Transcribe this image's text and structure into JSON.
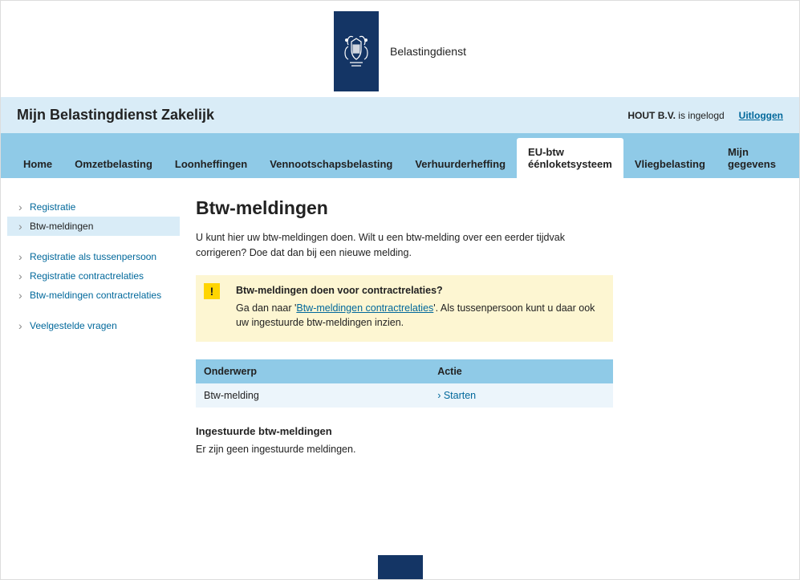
{
  "header": {
    "brand": "Belastingdienst"
  },
  "titleBar": {
    "title": "Mijn Belastingdienst Zakelijk",
    "userName": "HOUT B.V.",
    "loggedInSuffix": " is ingelogd",
    "logout": "Uitloggen"
  },
  "nav": {
    "items": [
      {
        "label": "Home"
      },
      {
        "label": "Omzetbelasting"
      },
      {
        "label": "Loonheffingen"
      },
      {
        "label": "Vennootschapsbelasting"
      },
      {
        "label": "Verhuurderheffing"
      },
      {
        "label": "EU-btw éénloketsysteem"
      },
      {
        "label": "Vliegbelasting"
      },
      {
        "label": "Mijn gegevens"
      }
    ]
  },
  "sidebar": {
    "group1": [
      {
        "label": "Registratie"
      },
      {
        "label": "Btw-meldingen"
      }
    ],
    "group2": [
      {
        "label": "Registratie als tussenpersoon"
      },
      {
        "label": "Registratie contractrelaties"
      },
      {
        "label": "Btw-meldingen contractrelaties"
      }
    ],
    "group3": [
      {
        "label": "Veelgestelde vragen"
      }
    ]
  },
  "content": {
    "heading": "Btw-meldingen",
    "intro": "U kunt hier uw btw-meldingen doen. Wilt u een btw-melding over een eerder tijdvak corrigeren? Doe dat dan bij een nieuwe melding.",
    "alert": {
      "iconChar": "!",
      "title": "Btw-meldingen doen voor contractrelaties?",
      "prefix": "Ga dan naar '",
      "link": "Btw-meldingen contractrelaties",
      "suffix": "'. Als tussenpersoon kunt u daar ook uw ingestuurde btw-meldingen inzien."
    },
    "table": {
      "colSubject": "Onderwerp",
      "colAction": "Actie",
      "rowSubject": "Btw-melding",
      "rowAction": "Starten"
    },
    "sentHeading": "Ingestuurde btw-meldingen",
    "sentEmpty": "Er zijn geen ingestuurde meldingen."
  }
}
